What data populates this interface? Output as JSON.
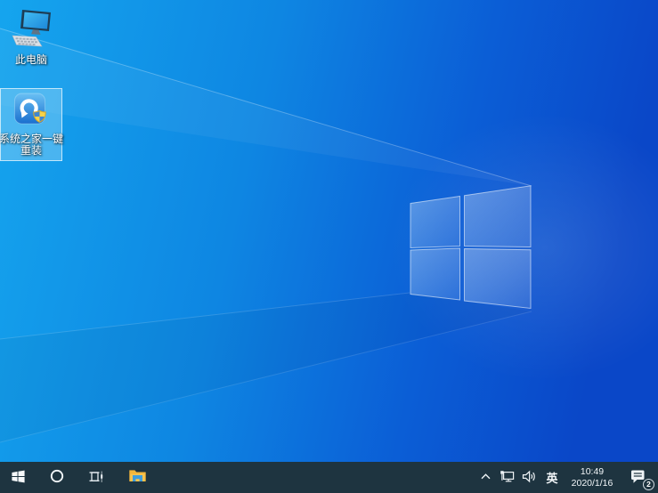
{
  "wallpaper": {
    "description": "windows-10-light-ray-logo",
    "gradient_left": "#15a5ee",
    "gradient_right": "#0a47c8"
  },
  "desktop_icons": [
    {
      "icon": "computer-icon",
      "label": "此电脑",
      "selected": false
    },
    {
      "icon": "reinstall-app-icon",
      "label_line1": "系统之家一键",
      "label_line2": "重装",
      "selected": true
    }
  ],
  "taskbar": {
    "background": "#1e3440",
    "buttons": [
      {
        "name": "start",
        "icon": "windows-logo-icon"
      },
      {
        "name": "search",
        "icon": "search-circle-icon"
      },
      {
        "name": "task-view",
        "icon": "task-view-icon"
      },
      {
        "name": "file-explorer",
        "icon": "folder-icon"
      }
    ],
    "tray": {
      "chevron_icon": "chevron-up-icon",
      "network_icon": "ethernet-icon",
      "volume_icon": "speaker-icon",
      "language": "英",
      "clock": {
        "time": "10:49",
        "date": "2020/1/16"
      },
      "notifications": {
        "icon": "action-center-icon",
        "count": "2"
      }
    }
  }
}
